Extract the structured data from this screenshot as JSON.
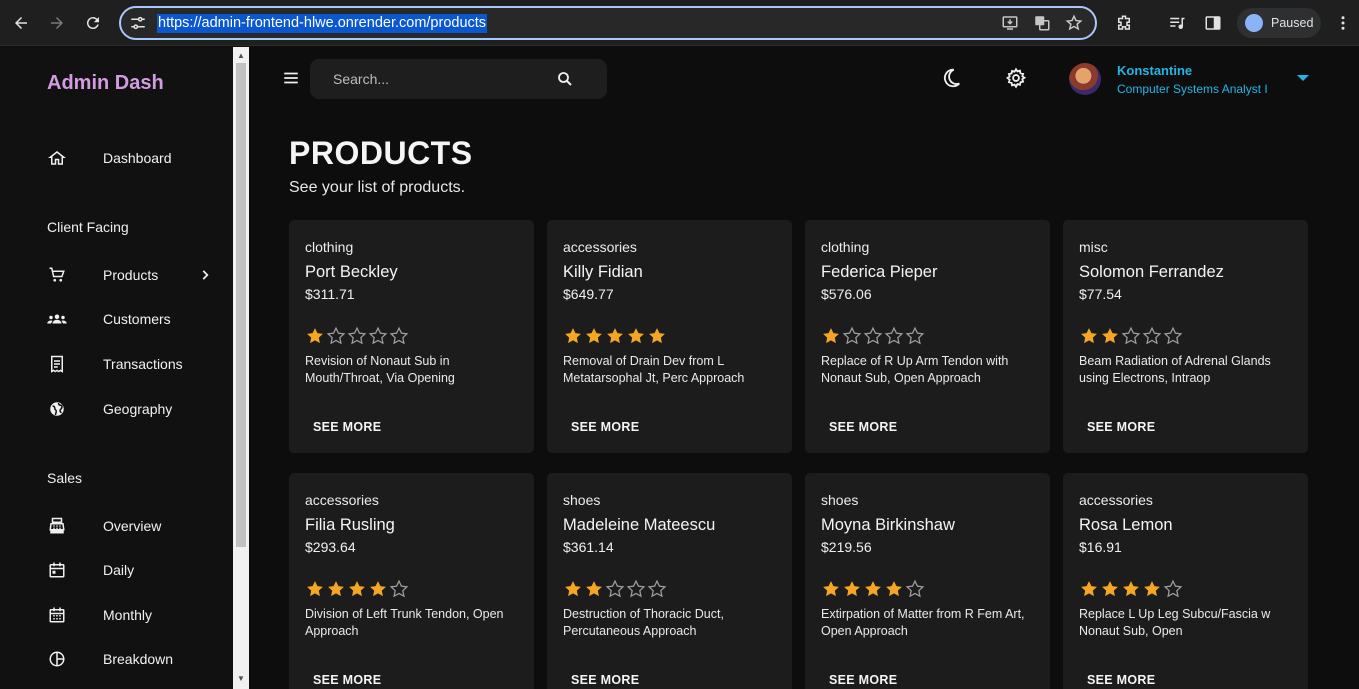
{
  "browser": {
    "url": "https://admin-frontend-hlwe.onrender.com/products",
    "profile_label": "Paused"
  },
  "sidebar": {
    "brand": "Admin Dash",
    "items": [
      {
        "label": "Dashboard",
        "icon": "home-icon"
      },
      {
        "section": "Client Facing"
      },
      {
        "label": "Products",
        "icon": "shopping-cart-icon",
        "has_chevron": true
      },
      {
        "label": "Customers",
        "icon": "groups-icon"
      },
      {
        "label": "Transactions",
        "icon": "receipt-icon"
      },
      {
        "label": "Geography",
        "icon": "globe-icon"
      },
      {
        "section": "Sales"
      },
      {
        "label": "Overview",
        "icon": "point-of-sale-icon"
      },
      {
        "label": "Daily",
        "icon": "calendar-today-icon"
      },
      {
        "label": "Monthly",
        "icon": "calendar-month-icon"
      },
      {
        "label": "Breakdown",
        "icon": "pie-chart-icon"
      }
    ]
  },
  "topbar": {
    "search_placeholder": "Search...",
    "user_name": "Konstantine",
    "user_role": "Computer Systems Analyst I"
  },
  "page": {
    "title": "PRODUCTS",
    "subtitle": "See your list of products."
  },
  "products": [
    {
      "category": "clothing",
      "name": "Port Beckley",
      "price": "$311.71",
      "rating": 1,
      "description": "Revision of Nonaut Sub in Mouth/Throat, Via Opening",
      "button": "SEE MORE"
    },
    {
      "category": "accessories",
      "name": "Killy Fidian",
      "price": "$649.77",
      "rating": 5,
      "description": "Removal of Drain Dev from L Metatarsophal Jt, Perc Approach",
      "button": "SEE MORE"
    },
    {
      "category": "clothing",
      "name": "Federica Pieper",
      "price": "$576.06",
      "rating": 1,
      "description": "Replace of R Up Arm Tendon with Nonaut Sub, Open Approach",
      "button": "SEE MORE"
    },
    {
      "category": "misc",
      "name": "Solomon Ferrandez",
      "price": "$77.54",
      "rating": 2,
      "description": "Beam Radiation of Adrenal Glands using Electrons, Intraop",
      "button": "SEE MORE"
    },
    {
      "category": "accessories",
      "name": "Filia Rusling",
      "price": "$293.64",
      "rating": 4,
      "description": "Division of Left Trunk Tendon, Open Approach",
      "button": "SEE MORE"
    },
    {
      "category": "shoes",
      "name": "Madeleine Mateescu",
      "price": "$361.14",
      "rating": 2,
      "description": "Destruction of Thoracic Duct, Percutaneous Approach",
      "button": "SEE MORE"
    },
    {
      "category": "shoes",
      "name": "Moyna Birkinshaw",
      "price": "$219.56",
      "rating": 4,
      "description": "Extirpation of Matter from R Fem Art, Open Approach",
      "button": "SEE MORE"
    },
    {
      "category": "accessories",
      "name": "Rosa Lemon",
      "price": "$16.91",
      "rating": 4,
      "description": "Replace L Up Leg Subcu/Fascia w Nonaut Sub, Open",
      "button": "SEE MORE"
    }
  ],
  "colors": {
    "star_filled": "#f5a623",
    "star_empty": "#9e9e9e",
    "brand": "#d49ce0",
    "user_accent": "#21b6e6",
    "card_bg": "#1c1c1c"
  }
}
